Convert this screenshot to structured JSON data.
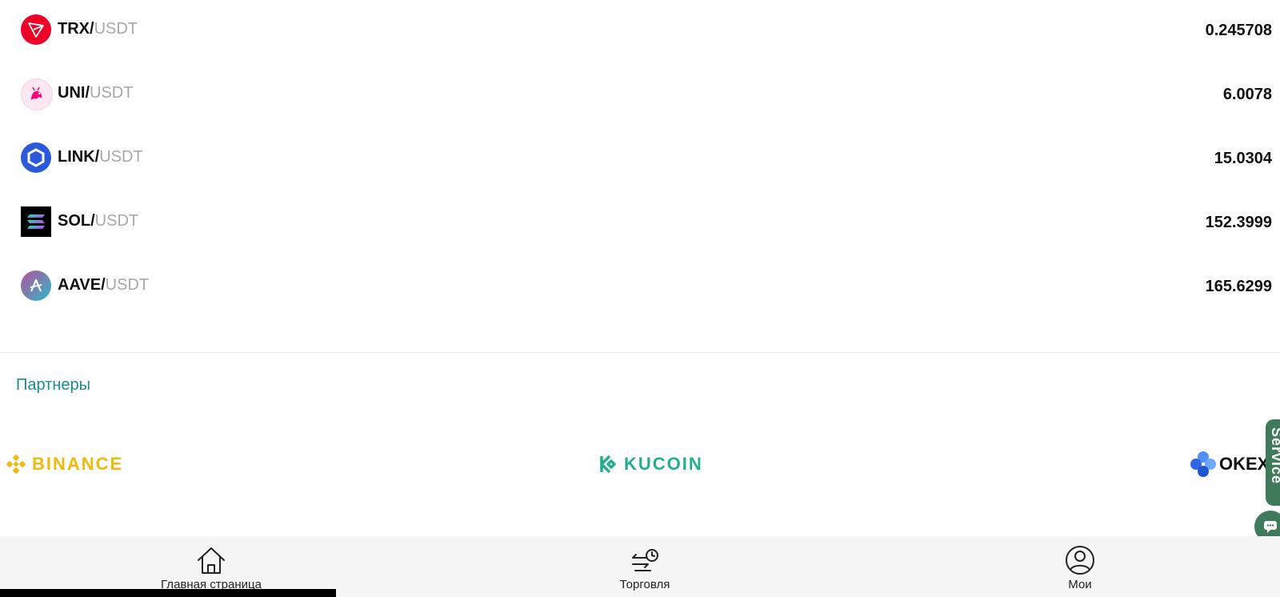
{
  "markets": [
    {
      "base": "TRX/",
      "quote": "USDT",
      "price": "0.245708",
      "icon": "tron-icon",
      "color": "#ef0027"
    },
    {
      "base": "UNI/",
      "quote": "USDT",
      "price": "6.0078",
      "icon": "uniswap-icon",
      "color": "#ff007a"
    },
    {
      "base": "LINK/",
      "quote": "USDT",
      "price": "15.0304",
      "icon": "chainlink-icon",
      "color": "#2a5ada"
    },
    {
      "base": "SOL/",
      "quote": "USDT",
      "price": "152.3999",
      "icon": "solana-icon",
      "color": "#000000"
    },
    {
      "base": "AAVE/",
      "quote": "USDT",
      "price": "165.6299",
      "icon": "aave-icon",
      "color": "#b6509e"
    }
  ],
  "partners": {
    "title": "Партнеры",
    "items": [
      {
        "name": "BINANCE",
        "icon": "binance-logo",
        "color": "#f0b90b"
      },
      {
        "name": "KUCOIN",
        "icon": "kucoin-logo",
        "color": "#24ae8f"
      },
      {
        "name": "OKEX",
        "icon": "okex-logo",
        "color": "#111111"
      }
    ]
  },
  "service": {
    "label": "Service",
    "color": "#3f7a5a"
  },
  "nav": {
    "home": "Главная страница",
    "trade": "Торговля",
    "mine": "Мои"
  }
}
